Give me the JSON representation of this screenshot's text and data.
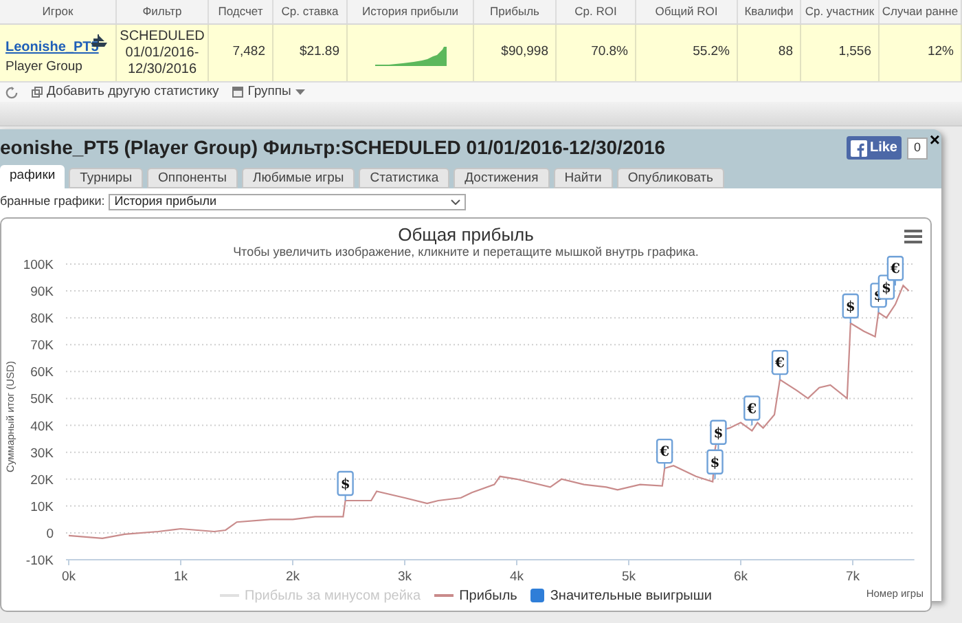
{
  "table": {
    "columns": [
      "Игрок",
      "Фильтр",
      "Подсчет",
      "Ср. ставка",
      "История прибыли",
      "Прибыль",
      "Ср. ROI",
      "Общий ROI",
      "Квалифи",
      "Ср. участник",
      "Случаи ранне"
    ],
    "rows": [
      {
        "player": "Leonishe_PT5",
        "group": "Player Group",
        "filter": "SCHEDULED 01/01/2016-12/30/2016",
        "count": "7,482",
        "avg_stake": "$21.89",
        "profit": "$90,998",
        "avg_roi": "70.8%",
        "total_roi": "55.2%",
        "itm": "88",
        "avg_entrants": "1,556",
        "early": "12%"
      }
    ]
  },
  "toolbar": [
    {
      "kind": "add",
      "label": "Добавить другую статистику"
    },
    {
      "kind": "groups",
      "label": "Группы"
    }
  ],
  "dialog": {
    "close": "×",
    "title": "eonishe_PT5 (Player Group) Фильтр:SCHEDULED 01/01/2016-12/30/2016",
    "like": {
      "label": "Like",
      "count": "0"
    },
    "tabs": [
      {
        "label": "рафики",
        "selected": true
      },
      {
        "label": "Турниры",
        "selected": false
      },
      {
        "label": "Оппоненты",
        "selected": false
      },
      {
        "label": "Любимые игры",
        "selected": false
      },
      {
        "label": "Статистика",
        "selected": false
      },
      {
        "label": "Достижения",
        "selected": false
      },
      {
        "label": "Найти",
        "selected": false
      },
      {
        "label": "Опубликовать",
        "selected": false
      }
    ],
    "chart_selector": {
      "label": "бранные графики:",
      "value": "История прибыли"
    },
    "chart_data": {
      "type": "line",
      "title": "Общая прибыль",
      "subtitle": "Чтобы увеличить изображение, кликните и перетащите мышкой внутрь графика.",
      "xlabel": "Номер игры",
      "ylabel": "Суммарный итог (USD)",
      "grid": true,
      "xlim": [
        0,
        7550
      ],
      "ylim": [
        -10000,
        100000
      ],
      "xticks": [
        {
          "value": 0,
          "label": "0k"
        },
        {
          "value": 1000,
          "label": "1k"
        },
        {
          "value": 2000,
          "label": "2k"
        },
        {
          "value": 3000,
          "label": "3k"
        },
        {
          "value": 4000,
          "label": "4k"
        },
        {
          "value": 5000,
          "label": "5k"
        },
        {
          "value": 6000,
          "label": "6k"
        },
        {
          "value": 7000,
          "label": "7k"
        }
      ],
      "yticks": [
        {
          "value": -10000,
          "label": "-10K"
        },
        {
          "value": 0,
          "label": "0"
        },
        {
          "value": 10000,
          "label": "10K"
        },
        {
          "value": 20000,
          "label": "20K"
        },
        {
          "value": 30000,
          "label": "30K"
        },
        {
          "value": 40000,
          "label": "40K"
        },
        {
          "value": 50000,
          "label": "50K"
        },
        {
          "value": 60000,
          "label": "60K"
        },
        {
          "value": 70000,
          "label": "70K"
        },
        {
          "value": 80000,
          "label": "80K"
        },
        {
          "value": 90000,
          "label": "90K"
        },
        {
          "value": 100000,
          "label": "100K"
        }
      ],
      "x": [
        0,
        300,
        500,
        800,
        1000,
        1300,
        1400,
        1500,
        1800,
        2000,
        2200,
        2450,
        2470,
        2700,
        2750,
        3000,
        3200,
        3300,
        3500,
        3600,
        3800,
        3850,
        4000,
        4300,
        4400,
        4600,
        4800,
        4900,
        5100,
        5300,
        5320,
        5400,
        5600,
        5750,
        5770,
        5800,
        5900,
        6000,
        6100,
        6150,
        6200,
        6300,
        6350,
        6500,
        6600,
        6700,
        6800,
        6950,
        6980,
        7100,
        7200,
        7230,
        7300,
        7380,
        7450,
        7500
      ],
      "series": [
        {
          "name": "Прибыль",
          "color": "#c98b8b",
          "values": [
            -1000,
            -2000,
            -500,
            500,
            1500,
            500,
            1000,
            4000,
            5000,
            5000,
            6000,
            6000,
            12000,
            12000,
            15500,
            13000,
            11000,
            12000,
            13000,
            15000,
            18000,
            21000,
            20000,
            17000,
            20000,
            18000,
            17000,
            16000,
            18000,
            17500,
            24000,
            25000,
            21000,
            19000,
            31000,
            38000,
            39000,
            41000,
            38000,
            41000,
            39000,
            44000,
            57000,
            53000,
            50000,
            54000,
            55000,
            50000,
            78000,
            75000,
            73000,
            82000,
            80000,
            85000,
            92000,
            90000
          ]
        }
      ],
      "annotations": [
        {
          "x": 2470,
          "y": 12000,
          "text": "$"
        },
        {
          "x": 5320,
          "y": 24000,
          "text": "€"
        },
        {
          "x": 5770,
          "y": 20000,
          "text": "$"
        },
        {
          "x": 5800,
          "y": 31000,
          "text": "$"
        },
        {
          "x": 6100,
          "y": 40000,
          "text": "€"
        },
        {
          "x": 6350,
          "y": 57000,
          "text": "€"
        },
        {
          "x": 6980,
          "y": 78000,
          "text": "$"
        },
        {
          "x": 7230,
          "y": 82000,
          "text": "$"
        },
        {
          "x": 7300,
          "y": 85000,
          "text": "$"
        },
        {
          "x": 7380,
          "y": 92000,
          "text": "€"
        }
      ]
    },
    "legend": [
      {
        "kind": "line",
        "label": "Прибыль за минусом рейка",
        "color": "#cccccc",
        "hidden": true
      },
      {
        "kind": "series",
        "hidden": false
      },
      {
        "kind": "square",
        "label": "Значительные выигрыши",
        "color": "#2f7ed8",
        "hidden": false
      }
    ]
  }
}
